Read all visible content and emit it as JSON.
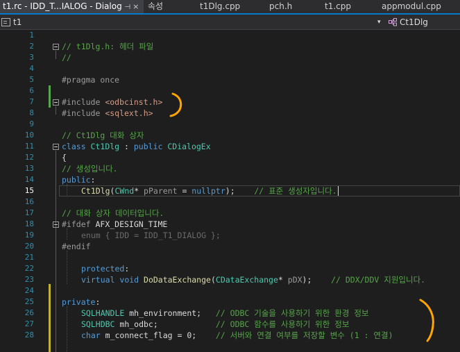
{
  "tabs": [
    {
      "label": "t1.rc - IDD_T...IALOG - Dialog",
      "active": true,
      "pin": "⊣",
      "close": "×"
    },
    {
      "label": "속성"
    },
    {
      "label": "t1Dlg.cpp"
    },
    {
      "label": "pch.h"
    },
    {
      "label": "t1.cpp"
    },
    {
      "label": "appmodul.cpp"
    }
  ],
  "nav": {
    "project": "t1",
    "dropdown_arrow": "▾",
    "class_scope": "Ct1Dlg"
  },
  "colors": {
    "accent": "#007acc",
    "comment": "#57a64a",
    "keyword": "#569cd6",
    "type": "#4ec9b0",
    "string": "#d69d85",
    "function": "#dcdcaa",
    "annotation": "#ffa500"
  },
  "lines": [
    {
      "n": "1",
      "t": []
    },
    {
      "n": "2",
      "t": [
        [
          "cm",
          "// t1Dlg.h: 헤더 파일"
        ]
      ]
    },
    {
      "n": "3",
      "t": [
        [
          "cm",
          "//"
        ]
      ]
    },
    {
      "n": "4",
      "t": []
    },
    {
      "n": "5",
      "t": [
        [
          "pp",
          "#pragma once"
        ]
      ]
    },
    {
      "n": "6",
      "t": []
    },
    {
      "n": "7",
      "t": [
        [
          "pp",
          "#include "
        ],
        [
          "str",
          "<odbcinst.h>"
        ]
      ]
    },
    {
      "n": "8",
      "t": [
        [
          "pp",
          "#include "
        ],
        [
          "str",
          "<sqlext.h>"
        ]
      ]
    },
    {
      "n": "9",
      "t": []
    },
    {
      "n": "10",
      "t": [
        [
          "cm",
          "// Ct1Dlg 대화 상자"
        ]
      ]
    },
    {
      "n": "11",
      "t": [
        [
          "kw",
          "class "
        ],
        [
          "ty",
          "Ct1Dlg"
        ],
        [
          "",
          " : "
        ],
        [
          "kw",
          "public "
        ],
        [
          "ty",
          "CDialogEx"
        ]
      ]
    },
    {
      "n": "12",
      "t": [
        [
          "",
          "{"
        ]
      ]
    },
    {
      "n": "13",
      "t": [
        [
          "cm",
          "// 생성입니다."
        ]
      ]
    },
    {
      "n": "14",
      "t": [
        [
          "kw",
          "public"
        ],
        [
          "",
          ":"
        ]
      ]
    },
    {
      "n": "15",
      "t": [
        [
          "fn",
          "Ct1Dlg"
        ],
        [
          "",
          "("
        ],
        [
          "ty",
          "CWnd"
        ],
        [
          "",
          "* "
        ],
        [
          "pm",
          "pParent"
        ],
        [
          "",
          " = "
        ],
        [
          "kw",
          "nullptr"
        ],
        [
          "",
          ");    "
        ],
        [
          "cm",
          "// 표준 생성자입니다."
        ]
      ],
      "indent": 1
    },
    {
      "n": "16",
      "t": []
    },
    {
      "n": "17",
      "t": [
        [
          "cm",
          "// 대화 상자 데이터입니다."
        ]
      ]
    },
    {
      "n": "18",
      "t": [
        [
          "pp",
          "#ifdef "
        ],
        [
          "",
          "AFX_DESIGN_TIME"
        ]
      ]
    },
    {
      "n": "19",
      "t": [
        [
          "dim",
          "enum { IDD = IDD_T1_DIALOG };"
        ]
      ],
      "indent": 1
    },
    {
      "n": "20",
      "t": [
        [
          "pp",
          "#endif"
        ]
      ]
    },
    {
      "n": "21",
      "t": []
    },
    {
      "n": "22",
      "t": [
        [
          "kw",
          "protected"
        ],
        [
          "",
          ":"
        ]
      ],
      "indent": 1
    },
    {
      "n": "23",
      "t": [
        [
          "kw",
          "virtual "
        ],
        [
          "kw",
          "void "
        ],
        [
          "fn",
          "DoDataExchange"
        ],
        [
          "",
          "("
        ],
        [
          "ty",
          "CDataExchange"
        ],
        [
          "",
          "* "
        ],
        [
          "pm",
          "pDX"
        ],
        [
          "",
          ");    "
        ],
        [
          "cm",
          "// DDX/DDV 지원입니다."
        ]
      ],
      "indent": 1
    },
    {
      "n": "24",
      "t": []
    },
    {
      "n": "25",
      "t": [
        [
          "kw",
          "private"
        ],
        [
          "",
          ":"
        ]
      ]
    },
    {
      "n": "26",
      "t": [
        [
          "ty",
          "SQLHANDLE"
        ],
        [
          "",
          " mh_environment;   "
        ],
        [
          "cm",
          "// ODBC 기술을 사용하기 위한 환경 정보"
        ]
      ],
      "indent": 1
    },
    {
      "n": "27",
      "t": [
        [
          "ty",
          "SQLHDBC"
        ],
        [
          "",
          " mh_odbc;            "
        ],
        [
          "cm",
          "// ODBC 함수를 사용하기 위한 정보"
        ]
      ],
      "indent": 1
    },
    {
      "n": "28",
      "t": [
        [
          "kw",
          "char"
        ],
        [
          "",
          " m_connect_flag = 0;    "
        ],
        [
          "cm",
          "// 서버와 연결 여부를 저장할 변수 (1 : 연결)"
        ]
      ],
      "indent": 1
    }
  ]
}
